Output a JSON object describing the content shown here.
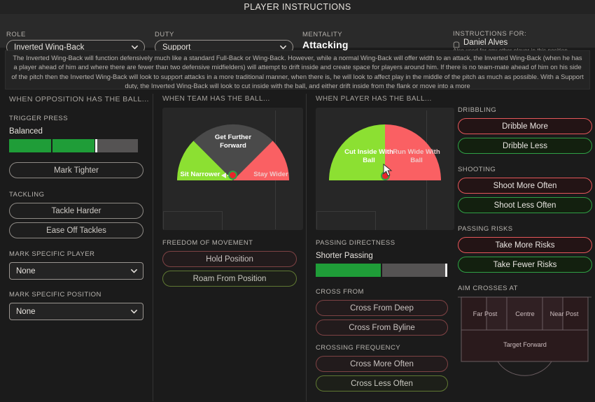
{
  "window": {
    "title": "PLAYER INSTRUCTIONS"
  },
  "header": {
    "role": {
      "label": "ROLE",
      "value": "Inverted Wing-Back",
      "icon": "chevron-down-icon"
    },
    "duty": {
      "label": "DUTY",
      "value": "Support",
      "icon": "chevron-down-icon"
    },
    "mentality": {
      "label": "MENTALITY",
      "value": "Attacking"
    },
    "instructions_for": {
      "label": "INSTRUCTIONS FOR:",
      "player": "Daniel Alves",
      "note": "Also used for any other player in this position",
      "icon": "player-shirt-icon"
    }
  },
  "description": "The Inverted Wing-Back will function defensively much like a standard Full-Back or Wing-Back. However, while a normal Wing-Back will offer width to an attack, the Inverted Wing-Back (when he has a player ahead of him and where there are fewer than two defensive midfielders) will attempt to drift inside and create space for players around him. If there is no team-mate ahead of him on his side of the pitch then the Inverted Wing-Back will look to support attacks in a more traditional manner, when there is, he will look to affect play in the middle of the pitch as much as possible. With a Support duty, the Inverted Wing-Back will look to cut inside with the ball, and either drift inside from the flank or move into a more",
  "columns": {
    "opposition": {
      "title": "WHEN OPPOSITION HAS THE BALL...",
      "trigger_press": {
        "label": "TRIGGER PRESS",
        "value": "Balanced",
        "segments": [
          "on",
          "on",
          "off"
        ],
        "segment_count": 3
      },
      "mark_tighter": {
        "label": "Mark Tighter",
        "state": "neutral"
      },
      "tackling": {
        "label": "TACKLING",
        "options": [
          {
            "label": "Tackle Harder",
            "state": "neutral"
          },
          {
            "label": "Ease Off Tackles",
            "state": "neutral"
          }
        ]
      },
      "mark_specific_player": {
        "label": "MARK SPECIFIC PLAYER",
        "value": "None",
        "icon": "chevron-down-icon"
      },
      "mark_specific_position": {
        "label": "MARK SPECIFIC POSITION",
        "value": "None",
        "icon": "chevron-down-icon"
      }
    },
    "team": {
      "title": "WHEN TEAM HAS THE BALL...",
      "dial": {
        "type": "three-sector-semicircle",
        "sectors": [
          {
            "label": "Sit Narrower",
            "color": "#8ce032",
            "position": "left"
          },
          {
            "label": "Get Further Forward",
            "color": "#4a4a4a",
            "position": "top"
          },
          {
            "label": "Stay Wider",
            "color": "#fa6063",
            "position": "right"
          }
        ],
        "selected": "Sit Narrower",
        "marker": "arrow-left-icon",
        "hub_color": "#e8252a",
        "hub_ring_color": "#2fa045"
      },
      "freedom_of_movement": {
        "label": "FREEDOM OF MOVEMENT",
        "options": [
          {
            "label": "Hold Position",
            "state": "dim-red"
          },
          {
            "label": "Roam From Position",
            "state": "dim-green"
          }
        ]
      }
    },
    "player": {
      "title": "WHEN PLAYER HAS THE BALL...",
      "dial": {
        "type": "two-sector-semicircle",
        "sectors": [
          {
            "label": "Cut Inside With Ball",
            "color": "#8ce032",
            "position": "left"
          },
          {
            "label": "Run Wide With Ball",
            "color": "#fa6063",
            "position": "right"
          }
        ],
        "selected": "Cut Inside With Ball",
        "hub_color": "#e8252a",
        "hub_ring_color": "#2fa045"
      },
      "passing_directness": {
        "label": "PASSING DIRECTNESS",
        "value": "Shorter Passing",
        "segments": [
          "on",
          "off"
        ],
        "segment_count": 2
      },
      "cross_from": {
        "label": "CROSS FROM",
        "options": [
          {
            "label": "Cross From Deep",
            "state": "dim-red"
          },
          {
            "label": "Cross From Byline",
            "state": "dim-red"
          }
        ]
      },
      "crossing_frequency": {
        "label": "CROSSING FREQUENCY",
        "options": [
          {
            "label": "Cross More Often",
            "state": "dim-red"
          },
          {
            "label": "Cross Less Often",
            "state": "dim-green"
          }
        ]
      }
    },
    "extra": {
      "dribbling": {
        "label": "DRIBBLING",
        "options": [
          {
            "label": "Dribble More",
            "state": "red"
          },
          {
            "label": "Dribble Less",
            "state": "green"
          }
        ]
      },
      "shooting": {
        "label": "SHOOTING",
        "options": [
          {
            "label": "Shoot More Often",
            "state": "red"
          },
          {
            "label": "Shoot Less Often",
            "state": "green"
          }
        ]
      },
      "passing_risks": {
        "label": "PASSING RISKS",
        "options": [
          {
            "label": "Take More Risks",
            "state": "red"
          },
          {
            "label": "Take Fewer Risks",
            "state": "green"
          }
        ]
      },
      "aim_crosses_at": {
        "label": "AIM CROSSES AT",
        "zones": [
          "Far Post",
          "Centre",
          "Near Post"
        ],
        "target": "Target Forward",
        "fill_color": "#2a1a1c"
      }
    }
  }
}
